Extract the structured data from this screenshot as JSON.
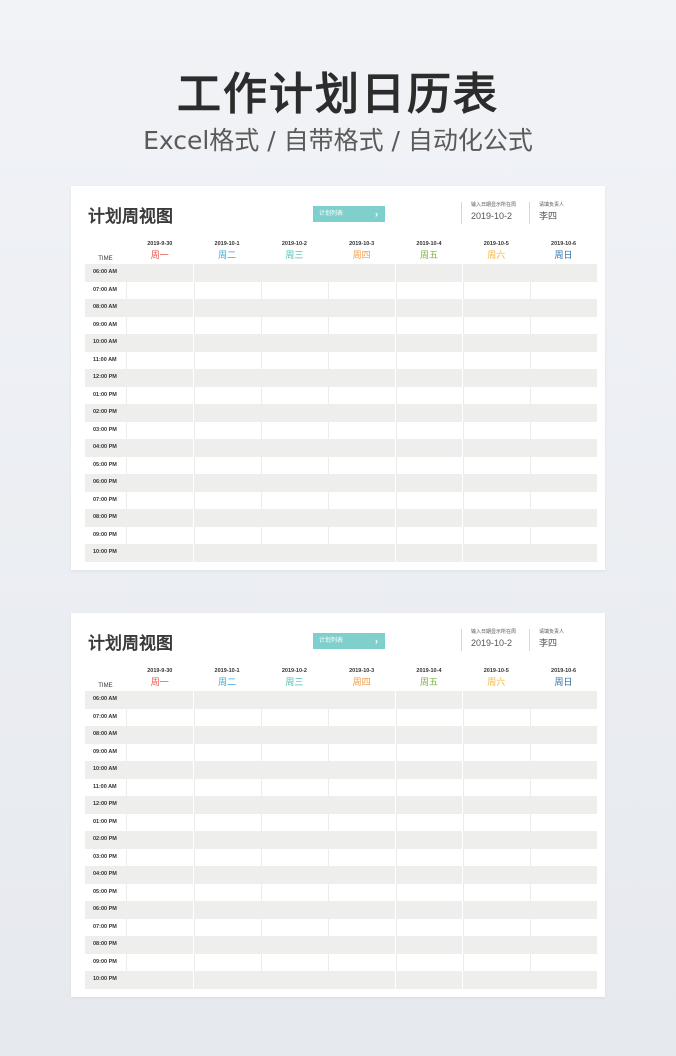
{
  "hero": {
    "title": "工作计划日历表",
    "subtitle": "Excel格式 / 自带格式 / 自动化公式"
  },
  "sheets": [
    {
      "title": "计划周视图",
      "button_label": "计划列表",
      "button_icon": "chevron-right-icon",
      "date_label": "输入日期显示所在周",
      "date_value": "2019-10-2",
      "person_label": "请填负责人",
      "person_value": "李四",
      "time_header": "TIME",
      "days": [
        {
          "date": "2019-9-30",
          "name": "周一",
          "color": "#e5564f"
        },
        {
          "date": "2019-10-1",
          "name": "周二",
          "color": "#3aa8d8"
        },
        {
          "date": "2019-10-2",
          "name": "周三",
          "color": "#4cbfb3"
        },
        {
          "date": "2019-10-3",
          "name": "周四",
          "color": "#f09a3e"
        },
        {
          "date": "2019-10-4",
          "name": "周五",
          "color": "#7cb342"
        },
        {
          "date": "2019-10-5",
          "name": "周六",
          "color": "#f2b53a"
        },
        {
          "date": "2019-10-6",
          "name": "周日",
          "color": "#2e6da4"
        }
      ],
      "times": [
        "06:00 AM",
        "07:00 AM",
        "08:00 AM",
        "09:00 AM",
        "10:00 AM",
        "11:00 AM",
        "12:00 PM",
        "01:00 PM",
        "02:00 PM",
        "03:00 PM",
        "04:00 PM",
        "05:00 PM",
        "06:00 PM",
        "07:00 PM",
        "08:00 PM",
        "09:00 PM",
        "10:00 PM"
      ]
    },
    {
      "title": "计划周视图",
      "button_label": "计划列表",
      "button_icon": "chevron-right-icon",
      "date_label": "输入日期显示所在周",
      "date_value": "2019-10-2",
      "person_label": "请填负责人",
      "person_value": "李四",
      "time_header": "TIME",
      "days": [
        {
          "date": "2019-9-30",
          "name": "周一",
          "color": "#e5564f"
        },
        {
          "date": "2019-10-1",
          "name": "周二",
          "color": "#3aa8d8"
        },
        {
          "date": "2019-10-2",
          "name": "周三",
          "color": "#4cbfb3"
        },
        {
          "date": "2019-10-3",
          "name": "周四",
          "color": "#f09a3e"
        },
        {
          "date": "2019-10-4",
          "name": "周五",
          "color": "#7cb342"
        },
        {
          "date": "2019-10-5",
          "name": "周六",
          "color": "#f2b53a"
        },
        {
          "date": "2019-10-6",
          "name": "周日",
          "color": "#2e6da4"
        }
      ],
      "times": [
        "06:00 AM",
        "07:00 AM",
        "08:00 AM",
        "09:00 AM",
        "10:00 AM",
        "11:00 AM",
        "12:00 PM",
        "01:00 PM",
        "02:00 PM",
        "03:00 PM",
        "04:00 PM",
        "05:00 PM",
        "06:00 PM",
        "07:00 PM",
        "08:00 PM",
        "09:00 PM",
        "10:00 PM"
      ]
    }
  ]
}
